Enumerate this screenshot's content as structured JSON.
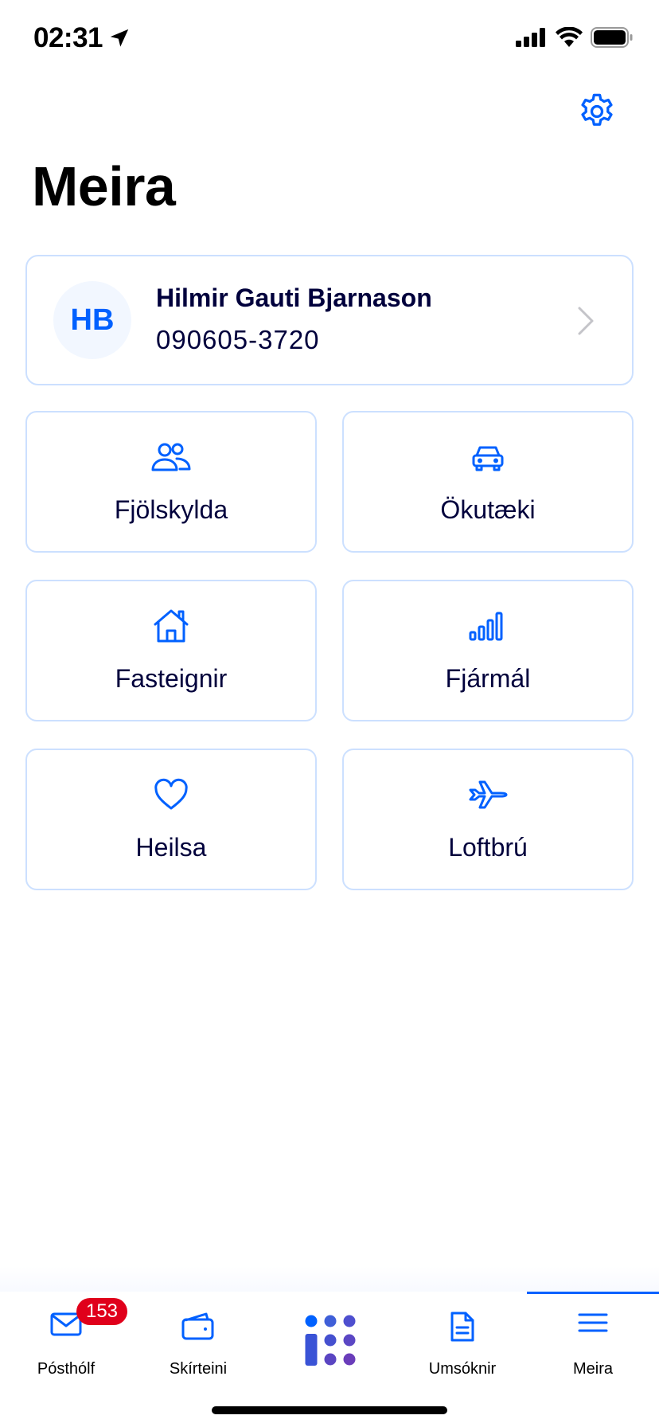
{
  "status_bar": {
    "time": "02:31"
  },
  "header": {
    "title": "Meira",
    "settings_icon": "gear-icon"
  },
  "profile": {
    "initials": "HB",
    "name": "Hilmir Gauti Bjarnason",
    "id": "090605-3720"
  },
  "tiles": [
    {
      "label": "Fjölskylda",
      "icon": "people-icon"
    },
    {
      "label": "Ökutæki",
      "icon": "car-icon"
    },
    {
      "label": "Fasteignir",
      "icon": "house-icon"
    },
    {
      "label": "Fjármál",
      "icon": "bar-chart-icon"
    },
    {
      "label": "Heilsa",
      "icon": "heart-icon"
    },
    {
      "label": "Loftbrú",
      "icon": "airplane-icon"
    }
  ],
  "tab_bar": {
    "active": "Meira",
    "tabs": [
      {
        "label": "Pósthólf",
        "icon": "mail-icon",
        "badge": "153"
      },
      {
        "label": "Skírteini",
        "icon": "wallet-icon"
      },
      {
        "label": "",
        "icon": "island-logo-icon"
      },
      {
        "label": "Umsóknir",
        "icon": "document-icon"
      },
      {
        "label": "Meira",
        "icon": "menu-icon"
      }
    ]
  },
  "colors": {
    "accent": "#0061ff",
    "border": "#cce0ff",
    "text": "#00003c",
    "badge": "#e0001b"
  }
}
